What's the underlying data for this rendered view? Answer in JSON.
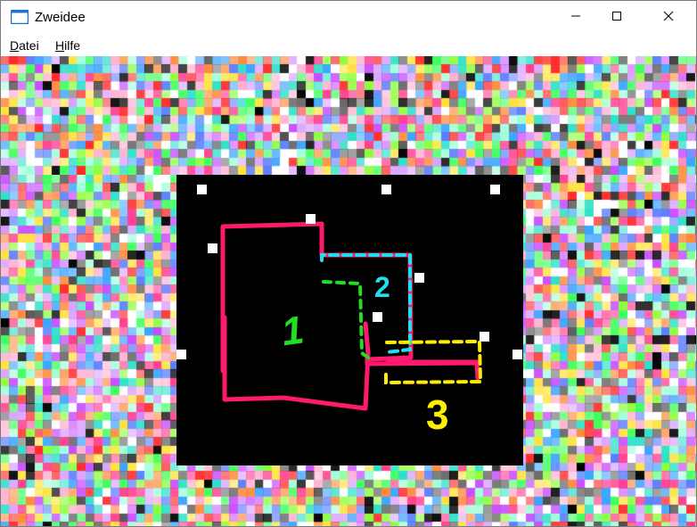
{
  "window": {
    "title": "Zweidee",
    "icon": "window-app-icon"
  },
  "caption_buttons": {
    "minimize_icon": "minimize-icon",
    "maximize_icon": "maximize-icon",
    "close_icon": "close-icon"
  },
  "menu": {
    "items": [
      {
        "mnemonic": "D",
        "rest": "atei"
      },
      {
        "mnemonic": "H",
        "rest": "ilfe"
      }
    ]
  },
  "canvas": {
    "background": "#000000",
    "labels": [
      {
        "text": "1",
        "color": "#22dd22"
      },
      {
        "text": "2",
        "color": "#22ddee"
      },
      {
        "text": "3",
        "color": "#ffee00"
      }
    ],
    "colors": {
      "shape_stroke": "#ff1a6e",
      "overlap_1": "#22dd22",
      "overlap_2": "#22ddee",
      "overlap_3": "#ffee00",
      "handle": "#ffffff"
    },
    "noise_palette": [
      "#ff3e8e",
      "#3cff5a",
      "#5a7dff",
      "#ffe23c",
      "#2ee0c8",
      "#c84cff",
      "#ff8a3c",
      "#8cff3c",
      "#ffffff",
      "#000000",
      "#ff2a2a",
      "#3ca4ff",
      "#d8a0ff",
      "#a0ffd8",
      "#ffb0d0",
      "#6e6e6e"
    ]
  }
}
